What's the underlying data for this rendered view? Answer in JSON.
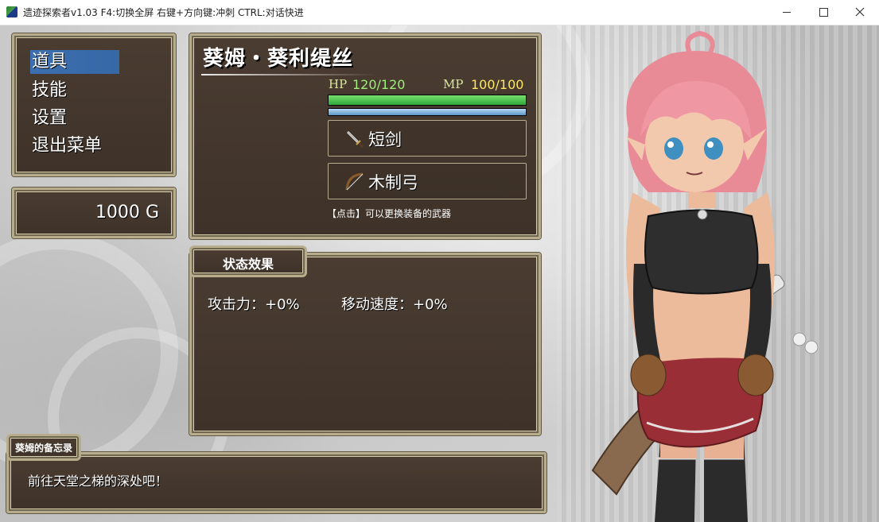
{
  "window": {
    "title": "遗迹探索者v1.03 F4:切换全屏 右键+方向键:冲刺 CTRL:对话快进"
  },
  "menu": {
    "items": [
      {
        "label": "道具",
        "selected": true
      },
      {
        "label": "技能",
        "selected": false
      },
      {
        "label": "设置",
        "selected": false
      },
      {
        "label": "退出菜单",
        "selected": false
      }
    ]
  },
  "gold": {
    "amount": "1000",
    "unit": "G"
  },
  "status": {
    "name": "葵姆・葵利缇丝",
    "hp_label": "HP",
    "hp_value": "120/120",
    "hp_fraction": 1.0,
    "mp_label": "MP",
    "mp_value": "100/100",
    "mp_fraction": 1.0,
    "weapons": [
      {
        "label": "短剑",
        "icon": "short-sword-icon"
      },
      {
        "label": "木制弓",
        "icon": "wooden-bow-icon"
      }
    ],
    "hint": "【点击】可以更换装备的武器"
  },
  "effects": {
    "tab_label": "状态效果",
    "items": [
      "攻击力：+0%",
      "移动速度：+0%"
    ]
  },
  "memo": {
    "tab_label": "葵姆的备忘录",
    "text": "前往天堂之梯的深处吧！"
  },
  "colors": {
    "panel_bg": "#43362c",
    "panel_border": "#b7ad8c",
    "selection": "#3d6fb0",
    "hp_bar": "#4ec54a",
    "mp_bar": "#8dbfe6"
  }
}
